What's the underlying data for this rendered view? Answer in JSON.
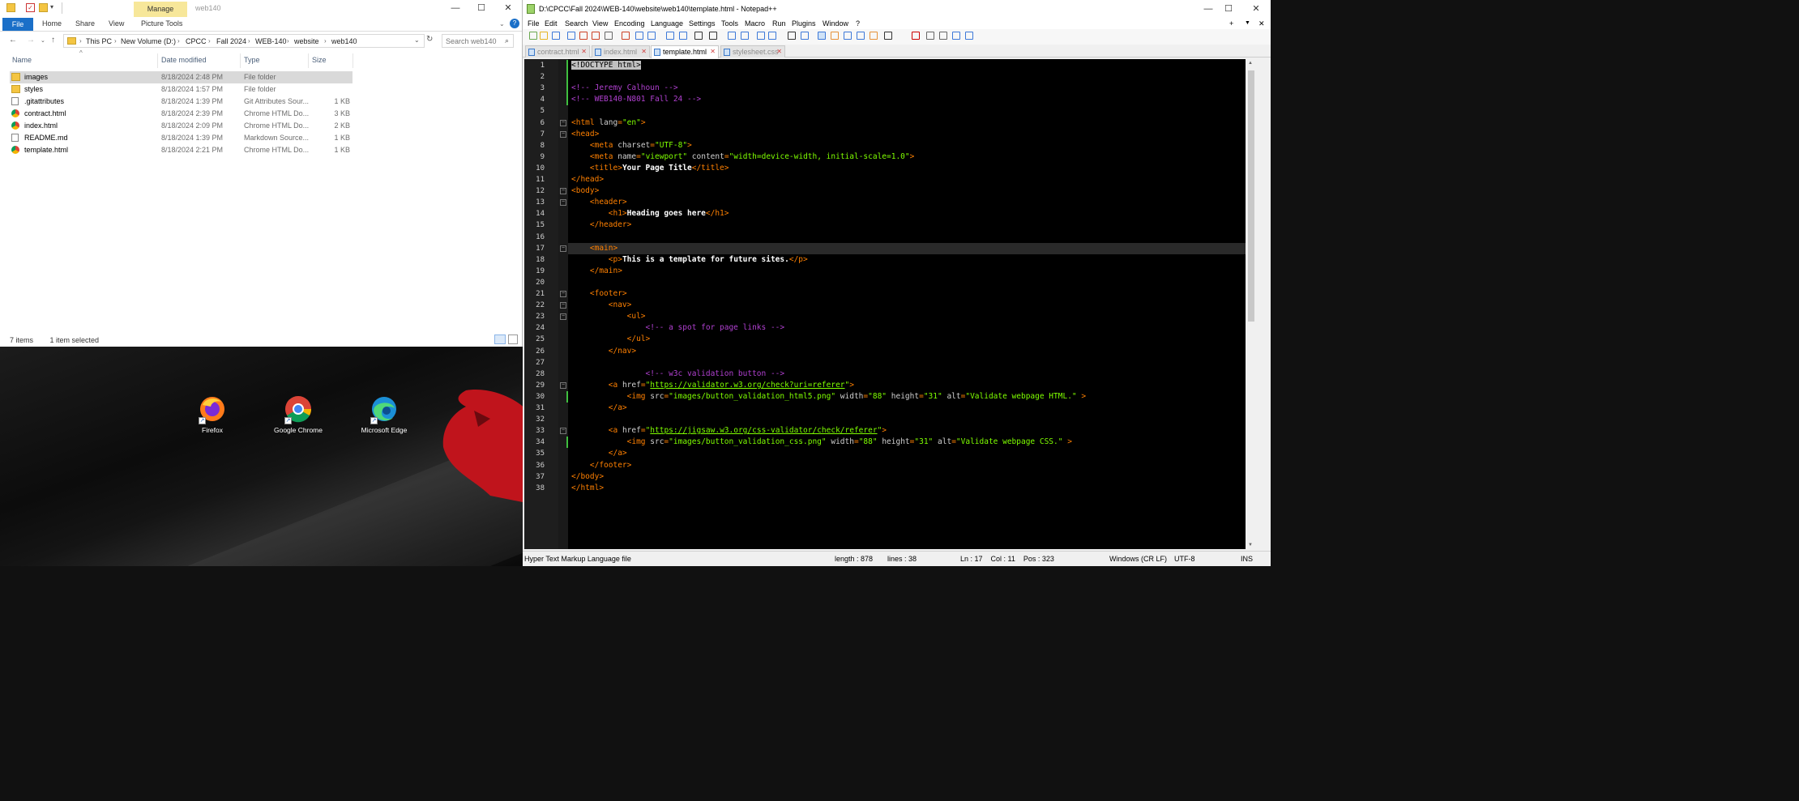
{
  "explorer": {
    "title": "web140",
    "context_tab": "Manage",
    "ribbon": {
      "file": "File",
      "tabs": [
        "Home",
        "Share",
        "View",
        "Picture Tools"
      ]
    },
    "breadcrumb": [
      "This PC",
      "New Volume (D:)",
      "CPCC",
      "Fall 2024",
      "WEB-140",
      "website",
      "web140"
    ],
    "search_placeholder": "Search web140",
    "columns": {
      "name": "Name",
      "date": "Date modified",
      "type": "Type",
      "size": "Size"
    },
    "files": [
      {
        "name": "images",
        "date": "8/18/2024 2:48 PM",
        "type": "File folder",
        "size": "",
        "icon": "folder-icon",
        "selected": true
      },
      {
        "name": "styles",
        "date": "8/18/2024 1:57 PM",
        "type": "File folder",
        "size": "",
        "icon": "folder-icon"
      },
      {
        "name": ".gitattributes",
        "date": "8/18/2024 1:39 PM",
        "type": "Git Attributes Sour...",
        "size": "1 KB",
        "icon": "document-icon"
      },
      {
        "name": "contract.html",
        "date": "8/18/2024 2:39 PM",
        "type": "Chrome HTML Do...",
        "size": "3 KB",
        "icon": "chrome-icon"
      },
      {
        "name": "index.html",
        "date": "8/18/2024 2:09 PM",
        "type": "Chrome HTML Do...",
        "size": "2 KB",
        "icon": "chrome-icon"
      },
      {
        "name": "README.md",
        "date": "8/18/2024 1:39 PM",
        "type": "Markdown Source...",
        "size": "1 KB",
        "icon": "document-icon"
      },
      {
        "name": "template.html",
        "date": "8/18/2024 2:21 PM",
        "type": "Chrome HTML Do...",
        "size": "1 KB",
        "icon": "chrome-icon"
      }
    ],
    "status": {
      "count": "7 items",
      "selection": "1 item selected"
    }
  },
  "desktop": {
    "icons": [
      {
        "label": "Firefox",
        "icon": "firefox-icon"
      },
      {
        "label": "Google Chrome",
        "icon": "chrome-icon"
      },
      {
        "label": "Microsoft Edge",
        "icon": "edge-icon"
      }
    ]
  },
  "npp": {
    "title": "D:\\CPCC\\Fall 2024\\WEB-140\\website\\web140\\template.html - Notepad++",
    "menu": [
      "File",
      "Edit",
      "Search",
      "View",
      "Encoding",
      "Language",
      "Settings",
      "Tools",
      "Macro",
      "Run",
      "Plugins",
      "Window",
      "?"
    ],
    "menu_right": [
      "+",
      "▼",
      "✕"
    ],
    "tabs": [
      {
        "label": "contract.html",
        "active": false
      },
      {
        "label": "index.html",
        "active": false
      },
      {
        "label": "template.html",
        "active": true
      },
      {
        "label": "stylesheet.css",
        "active": false
      }
    ],
    "lines": [
      [
        [
          "sel",
          "<!DOCTYPE html>"
        ]
      ],
      [],
      [
        [
          "cm",
          "<!-- Jeremy Calhoun -->"
        ]
      ],
      [
        [
          "cm",
          "<!-- WEB140-N801 Fall 24 -->"
        ]
      ],
      [],
      [
        [
          "tg",
          "<html "
        ],
        [
          "at",
          "lang"
        ],
        [
          "tg",
          "="
        ],
        [
          "st",
          "\"en\""
        ],
        [
          "tg",
          ">"
        ]
      ],
      [
        [
          "tg",
          "<head>"
        ]
      ],
      [
        [
          "tx",
          "    "
        ],
        [
          "tg",
          "<meta "
        ],
        [
          "at",
          "charset"
        ],
        [
          "tg",
          "="
        ],
        [
          "st",
          "\"UTF-8\""
        ],
        [
          "tg",
          ">"
        ]
      ],
      [
        [
          "tx",
          "    "
        ],
        [
          "tg",
          "<meta "
        ],
        [
          "at",
          "name"
        ],
        [
          "tg",
          "="
        ],
        [
          "st",
          "\"viewport\""
        ],
        [
          "tx",
          " "
        ],
        [
          "at",
          "content"
        ],
        [
          "tg",
          "="
        ],
        [
          "st",
          "\"width=device-width, initial-scale=1.0\""
        ],
        [
          "tg",
          ">"
        ]
      ],
      [
        [
          "tx",
          "    "
        ],
        [
          "tg",
          "<title>"
        ],
        [
          "bd",
          "Your Page Title"
        ],
        [
          "tg",
          "</title>"
        ]
      ],
      [
        [
          "tg",
          "</head>"
        ]
      ],
      [
        [
          "tg",
          "<body>"
        ]
      ],
      [
        [
          "tx",
          "    "
        ],
        [
          "tg",
          "<header>"
        ]
      ],
      [
        [
          "tx",
          "        "
        ],
        [
          "tg",
          "<h1>"
        ],
        [
          "bd",
          "Heading goes here"
        ],
        [
          "tg",
          "</h1>"
        ]
      ],
      [
        [
          "tx",
          "    "
        ],
        [
          "tg",
          "</header>"
        ]
      ],
      [],
      [
        [
          "tx",
          "    "
        ],
        [
          "tg",
          "<main>"
        ]
      ],
      [
        [
          "tx",
          "        "
        ],
        [
          "tg",
          "<p>"
        ],
        [
          "bd",
          "This is a template for future sites."
        ],
        [
          "tg",
          "</p>"
        ]
      ],
      [
        [
          "tx",
          "    "
        ],
        [
          "tg",
          "</main>"
        ]
      ],
      [],
      [
        [
          "tx",
          "    "
        ],
        [
          "tg",
          "<footer>"
        ]
      ],
      [
        [
          "tx",
          "        "
        ],
        [
          "tg",
          "<nav>"
        ]
      ],
      [
        [
          "tx",
          "            "
        ],
        [
          "tg",
          "<ul>"
        ]
      ],
      [
        [
          "tx",
          "                "
        ],
        [
          "cm",
          "<!-- a spot for page links -->"
        ]
      ],
      [
        [
          "tx",
          "            "
        ],
        [
          "tg",
          "</ul>"
        ]
      ],
      [
        [
          "tx",
          "        "
        ],
        [
          "tg",
          "</nav>"
        ]
      ],
      [],
      [
        [
          "tx",
          "                "
        ],
        [
          "cm",
          "<!-- w3c validation button -->"
        ]
      ],
      [
        [
          "tx",
          "        "
        ],
        [
          "tg",
          "<a "
        ],
        [
          "at",
          "href"
        ],
        [
          "tg",
          "="
        ],
        [
          "st",
          "\""
        ],
        [
          "lk",
          "https://validator.w3.org/check?uri=referer"
        ],
        [
          "st",
          "\""
        ],
        [
          "tg",
          ">"
        ]
      ],
      [
        [
          "tx",
          "            "
        ],
        [
          "tg",
          "<img "
        ],
        [
          "at",
          "src"
        ],
        [
          "tg",
          "="
        ],
        [
          "st",
          "\"images/button_validation_html5.png\""
        ],
        [
          "tx",
          " "
        ],
        [
          "at",
          "width"
        ],
        [
          "tg",
          "="
        ],
        [
          "st",
          "\"88\""
        ],
        [
          "tx",
          " "
        ],
        [
          "at",
          "height"
        ],
        [
          "tg",
          "="
        ],
        [
          "st",
          "\"31\""
        ],
        [
          "tx",
          " "
        ],
        [
          "at",
          "alt"
        ],
        [
          "tg",
          "="
        ],
        [
          "st",
          "\"Validate webpage HTML.\""
        ],
        [
          "tx",
          " "
        ],
        [
          "tg",
          ">"
        ]
      ],
      [
        [
          "tx",
          "        "
        ],
        [
          "tg",
          "</a>"
        ]
      ],
      [],
      [
        [
          "tx",
          "        "
        ],
        [
          "tg",
          "<a "
        ],
        [
          "at",
          "href"
        ],
        [
          "tg",
          "="
        ],
        [
          "st",
          "\""
        ],
        [
          "lk",
          "https://jigsaw.w3.org/css-validator/check/referer"
        ],
        [
          "st",
          "\""
        ],
        [
          "tg",
          ">"
        ]
      ],
      [
        [
          "tx",
          "            "
        ],
        [
          "tg",
          "<img "
        ],
        [
          "at",
          "src"
        ],
        [
          "tg",
          "="
        ],
        [
          "st",
          "\"images/button_validation_css.png\""
        ],
        [
          "tx",
          " "
        ],
        [
          "at",
          "width"
        ],
        [
          "tg",
          "="
        ],
        [
          "st",
          "\"88\""
        ],
        [
          "tx",
          " "
        ],
        [
          "at",
          "height"
        ],
        [
          "tg",
          "="
        ],
        [
          "st",
          "\"31\""
        ],
        [
          "tx",
          " "
        ],
        [
          "at",
          "alt"
        ],
        [
          "tg",
          "="
        ],
        [
          "st",
          "\"Validate webpage CSS.\""
        ],
        [
          "tx",
          " "
        ],
        [
          "tg",
          ">"
        ]
      ],
      [
        [
          "tx",
          "        "
        ],
        [
          "tg",
          "</a>"
        ]
      ],
      [
        [
          "tx",
          "    "
        ],
        [
          "tg",
          "</footer>"
        ]
      ],
      [
        [
          "tg",
          "</body>"
        ]
      ],
      [
        [
          "tg",
          "</html>"
        ]
      ]
    ],
    "current_line": 17,
    "status": {
      "language": "Hyper Text Markup Language file",
      "length": "length : 878",
      "lines": "lines : 38",
      "position": "Ln : 17    Col : 11    Pos : 323",
      "eol": "Windows (CR LF)",
      "encoding": "UTF-8",
      "mode": "INS"
    },
    "colors": {
      "tag": "#ff8000",
      "attr": "#d0d0d0",
      "string": "#7fff00",
      "comment": "#b040d0",
      "text": "#ffffff",
      "link": "#7fff00"
    }
  }
}
